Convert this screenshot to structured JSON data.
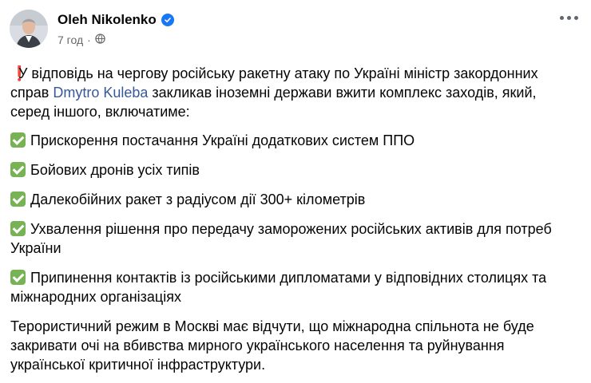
{
  "author": {
    "name": "Oleh Nikolenko",
    "time": "7 год",
    "verified": true,
    "privacy_icon": "globe-icon"
  },
  "post": {
    "intro_emoji": "❗",
    "intro_part1": "У відповідь на чергову російську ракетну атаку по Україні міністр закордонних справ ",
    "mention": "Dmytro Kuleba",
    "intro_part2": " закликав іноземні держави вжити комплекс заходів, який, серед іншого, включатиме:",
    "bullet_icon": "check-mark-button-icon",
    "bullets": [
      "Прискорення постачання Україні додаткових систем ППО",
      "Бойових дронів усіх типів",
      "Далекобійних ракет з радіусом дії 300+ кілометрів",
      "Ухвалення рішення про передачу заморожених російських активів для потреб України",
      "Припинення контактів із російськими дипломатами у відповідних столицях та міжнародних організаціях"
    ],
    "closing": "Терористичний режим в Москві має відчути, що міжнародна спільнота не буде закривати очі на вбивства мирного українського населення та руйнування української критичної інфраструктури."
  },
  "colors": {
    "link": "#385898",
    "meta": "#65676b",
    "verified": "#1877f2",
    "check": "#77b255",
    "exclamation": "#dd2e44"
  }
}
